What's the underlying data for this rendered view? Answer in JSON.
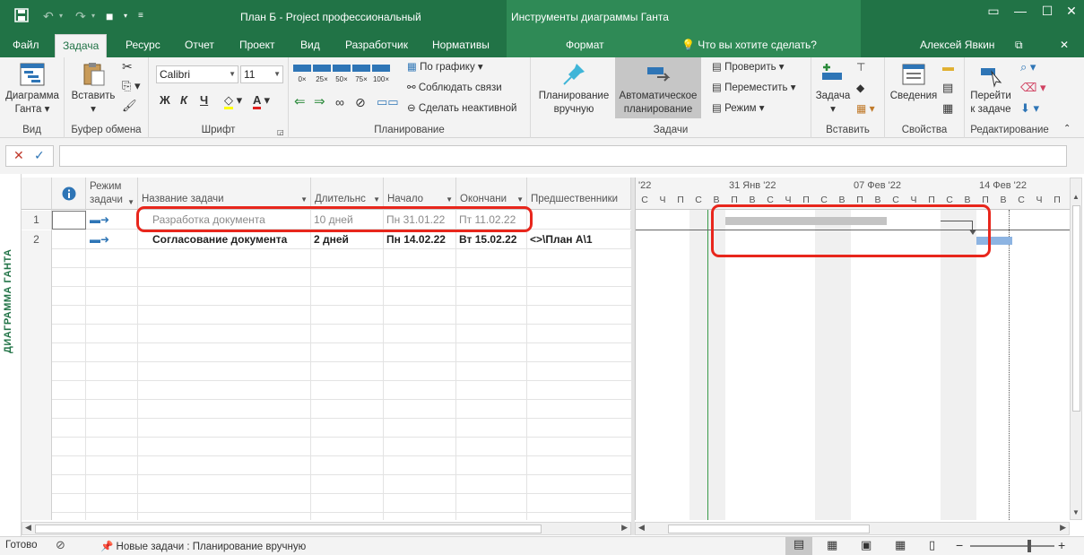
{
  "window": {
    "title": "План Б - Project профессиональный",
    "context_title": "Инструменты диаграммы Ганта",
    "user": "Алексей Явкин",
    "search_placeholder": "Что вы хотите сделать?"
  },
  "tabs": [
    "Файл",
    "Задача",
    "Ресурс",
    "Отчет",
    "Проект",
    "Вид",
    "Разработчик",
    "Нормативы",
    "Формат"
  ],
  "ribbon": {
    "vid": {
      "btn1": "Диаграмма",
      "btn2": "Ганта",
      "label": "Вид"
    },
    "buffer": {
      "paste": "Вставить",
      "label": "Буфер обмена"
    },
    "font": {
      "name": "Calibri",
      "size": "11",
      "bold": "Ж",
      "italic": "К",
      "underline": "Ч",
      "label": "Шрифт"
    },
    "planning": {
      "by_schedule": "По графику",
      "respect_links": "Соблюдать связи",
      "deactivate": "Сделать неактивной",
      "label": "Планирование",
      "pct": [
        "0×",
        "25×",
        "50×",
        "75×",
        "100×"
      ]
    },
    "tasks": {
      "manual1": "Планирование",
      "manual2": "вручную",
      "auto1": "Автоматическое",
      "auto2": "планирование",
      "check": "Проверить",
      "move": "Переместить",
      "mode": "Режим",
      "label": "Задачи"
    },
    "insert": {
      "task": "Задача",
      "label": "Вставить"
    },
    "props": {
      "info": "Сведения",
      "label": "Свойства"
    },
    "edit": {
      "goto1": "Перейти",
      "goto2": "к задаче",
      "label": "Редактирование"
    }
  },
  "view_label": "ДИАГРАММА ГАНТА",
  "columns": {
    "mode1": "Режим",
    "mode2": "задачи",
    "name": "Название задачи",
    "duration": "Длительнс",
    "start": "Начало",
    "finish": "Окончани",
    "pred": "Предшественники"
  },
  "rows": [
    {
      "num": "1",
      "name": "Разработка документа",
      "duration": "10 дней",
      "start": "Пн 31.01.22",
      "finish": "Пт 11.02.22",
      "pred": "",
      "inactive": true
    },
    {
      "num": "2",
      "name": "Согласование документа",
      "duration": "2 дней",
      "start": "Пн 14.02.22",
      "finish": "Вт 15.02.22",
      "pred": "<>\\План А\\1",
      "inactive": false
    }
  ],
  "gantt": {
    "weeks": [
      "'22",
      "31 Янв '22",
      "07 Фев '22",
      "14 Фев '22"
    ],
    "days": [
      "С",
      "Ч",
      "П",
      "С",
      "В",
      "П",
      "В",
      "С",
      "Ч",
      "П",
      "С",
      "В",
      "П",
      "В",
      "С",
      "Ч",
      "П",
      "С",
      "В",
      "П",
      "В",
      "С",
      "Ч",
      "П"
    ],
    "bar_colors": {
      "inactive": "#c4c4c4",
      "active": "#8db4e2"
    }
  },
  "status": {
    "ready": "Готово",
    "new_tasks": "Новые задачи : Планирование вручную"
  }
}
